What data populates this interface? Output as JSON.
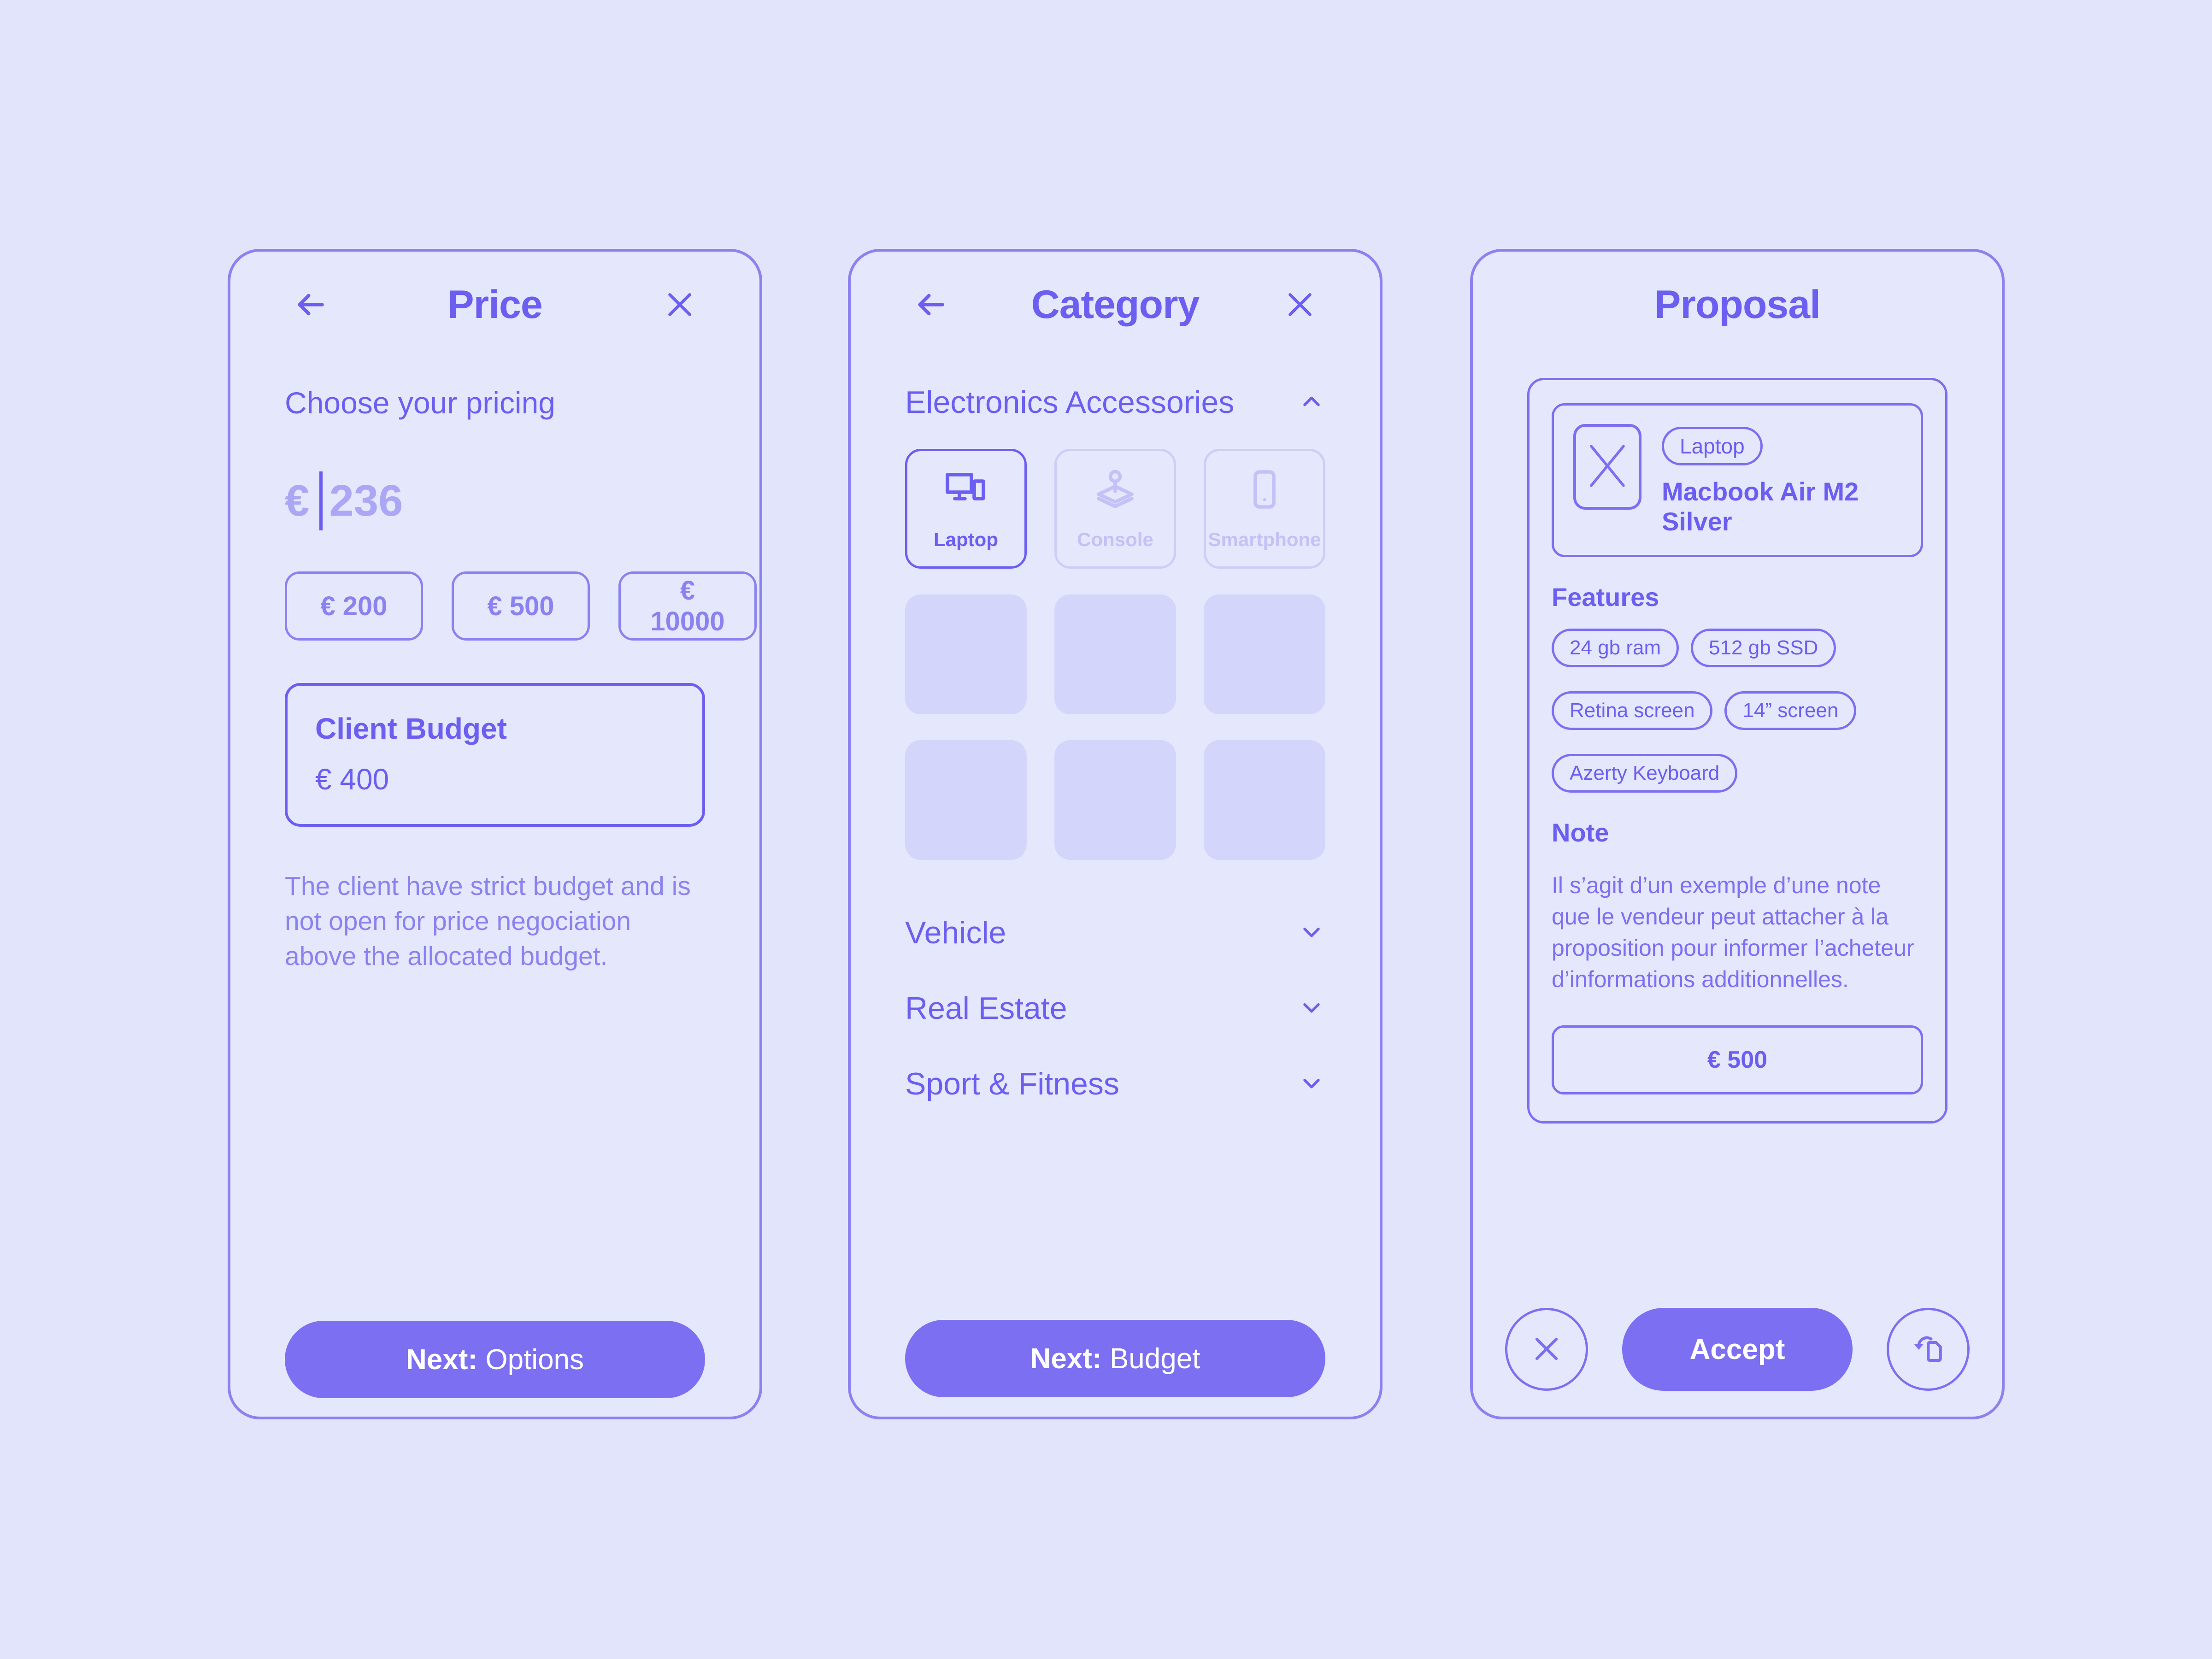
{
  "theme": {
    "page_bg": "#e2e4fb",
    "panel_bg": "#e5e7fc",
    "accent": "#6b5ef0",
    "accent_soft": "#8b82f0",
    "accent_button": "#7c6ff2",
    "muted": "#aca7f4",
    "disabled": "#c4c1f6",
    "skeleton": "#d4d5fa"
  },
  "price_screen": {
    "title": "Price",
    "back_icon": "arrow-left-icon",
    "close_icon": "close-icon",
    "section_label": "Choose your pricing",
    "currency_symbol": "€",
    "amount_value": "236",
    "presets": [
      "€ 200",
      "€ 500",
      "€ 10000"
    ],
    "budget": {
      "label": "Client Budget",
      "value": "€ 400"
    },
    "note": "The client have strict budget and is not open for price negociation above the allocated budget.",
    "cta": {
      "prefix": "Next:",
      "label": "Options"
    }
  },
  "category_screen": {
    "title": "Category",
    "back_icon": "arrow-left-icon",
    "close_icon": "close-icon",
    "expanded_group": {
      "label": "Electronics Accessories",
      "chevron_icon": "chevron-up-icon",
      "items": [
        {
          "label": "Laptop",
          "icon": "monitor-device-icon",
          "selected": true
        },
        {
          "label": "Console",
          "icon": "joystick-icon",
          "selected": false
        },
        {
          "label": "Smartphone",
          "icon": "smartphone-icon",
          "selected": false
        }
      ],
      "placeholder_count": 6
    },
    "collapsed_groups": [
      {
        "label": "Vehicle",
        "chevron_icon": "chevron-down-icon"
      },
      {
        "label": "Real Estate",
        "chevron_icon": "chevron-down-icon"
      },
      {
        "label": "Sport & Fitness",
        "chevron_icon": "chevron-down-icon"
      }
    ],
    "cta": {
      "prefix": "Next:",
      "label": "Budget"
    }
  },
  "proposal_screen": {
    "title": "Proposal",
    "product": {
      "thumb_icon": "image-placeholder-icon",
      "tag": "Laptop",
      "name": "Macbook Air M2 Silver"
    },
    "features_title": "Features",
    "features": [
      "24 gb ram",
      "512 gb SSD",
      "Retina screen",
      "14” screen",
      "Azerty Keyboard"
    ],
    "note_title": "Note",
    "note_body": "Il s’agit d’un exemple d’une note que le vendeur peut attacher à la proposition pour informer l’acheteur d’informations additionnelles.",
    "price": "€ 500",
    "actions": {
      "decline_icon": "close-icon",
      "accept_label": "Accept",
      "counter_icon": "counter-offer-document-icon"
    }
  }
}
